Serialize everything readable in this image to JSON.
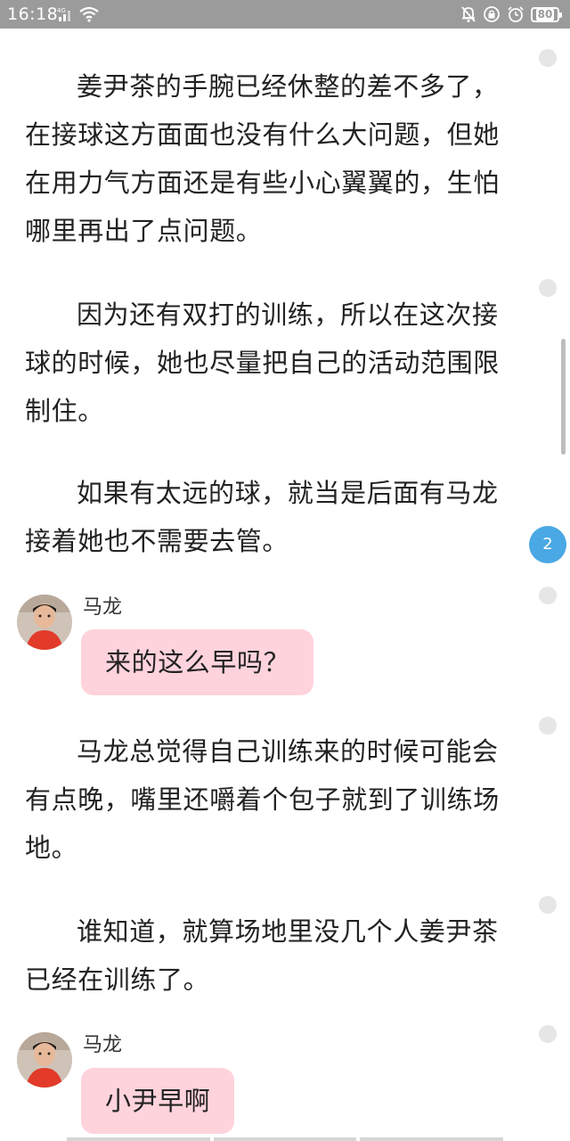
{
  "status_bar": {
    "time": "16:18",
    "network": "4G",
    "battery": "80",
    "icons_left": [
      "signal-icon",
      "wifi-icon"
    ],
    "icons_right": [
      "bell-muted-icon",
      "orientation-lock-icon",
      "alarm-icon",
      "battery-icon"
    ]
  },
  "paragraphs": [
    "姜尹茶的手腕已经休整的差不多了，在接球这方面面也没有什么大问题，但她在用力气方面还是有些小心翼翼的，生怕哪里再出了点问题。",
    "因为还有双打的训练，所以在这次接球的时候，她也尽量把自己的活动范围限制住。",
    "如果有太远的球，就当是后面有马龙接着她也不需要去管。",
    "马龙总觉得自己训练来的时候可能会有点晚，嘴里还嚼着个包子就到了训练场地。",
    "谁知道，就算场地里没几个人姜尹茶已经在训练了。"
  ],
  "messages": [
    {
      "sender": "马龙",
      "text": "来的这么早吗？"
    },
    {
      "sender": "马龙",
      "text": "小尹早啊"
    }
  ],
  "comments": {
    "badge_count": "2"
  },
  "colors": {
    "status_bar_bg": "#9b9b9b",
    "bubble_bg": "#ffd3dc",
    "comment_badge": "#4aa8e4",
    "comment_dot": "#e6e6e6"
  }
}
